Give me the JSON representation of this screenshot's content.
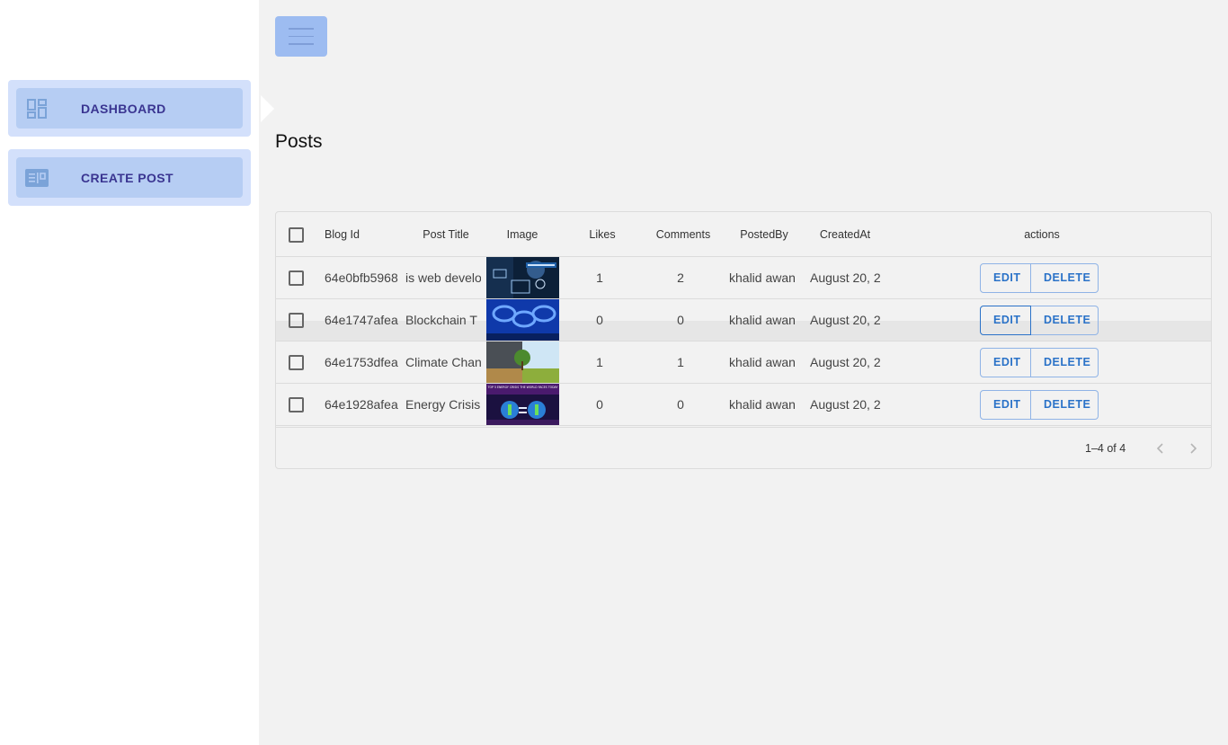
{
  "sidebar": {
    "items": [
      {
        "label": "DASHBOARD",
        "icon": "dashboard-icon"
      },
      {
        "label": "CREATE POST",
        "icon": "post-icon"
      }
    ]
  },
  "header": {
    "menu_icon": "hamburger-icon"
  },
  "page": {
    "title": "Posts"
  },
  "table": {
    "columns": [
      "Blog Id",
      "Post Title",
      "Image",
      "Likes",
      "Comments",
      "PostedBy",
      "CreatedAt",
      "actions"
    ],
    "rows": [
      {
        "id": "64e0bfb5968",
        "title": "is web develo",
        "image": "web development thumbnail",
        "likes": "1",
        "comments": "2",
        "posted_by": "khalid awan",
        "created_at": "August 20, 2"
      },
      {
        "id": "64e1747afea",
        "title": "Blockchain T",
        "image": "blockchain thumbnail",
        "likes": "0",
        "comments": "0",
        "posted_by": "khalid awan",
        "created_at": "August 20, 2"
      },
      {
        "id": "64e1753dfea",
        "title": "Climate Chan",
        "image": "climate change thumbnail",
        "likes": "1",
        "comments": "1",
        "posted_by": "khalid awan",
        "created_at": "August 20, 2"
      },
      {
        "id": "64e1928afea",
        "title": "Energy Crisis",
        "image": "energy crisis thumbnail",
        "likes": "0",
        "comments": "0",
        "posted_by": "khalid awan",
        "created_at": "August 20, 2"
      }
    ],
    "edit_label": "EDIT",
    "delete_label": "DELETE"
  },
  "thumbs": {
    "energy_caption": "TOP 5 ENERGY CRISIS THE WORLD FACES TODAY"
  },
  "pagination": {
    "text": "1–4 of 4"
  },
  "colors": {
    "accent": "#2a72c8",
    "nav_text": "#3a3591",
    "nav_bg": "#b6cdf3"
  }
}
